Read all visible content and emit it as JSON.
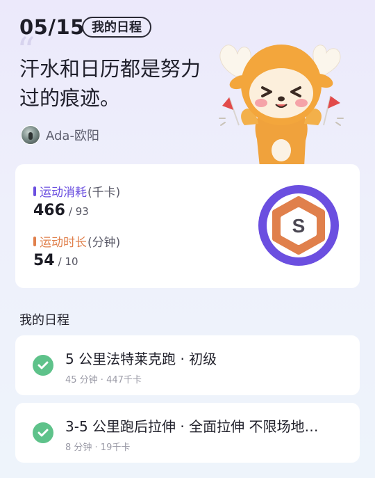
{
  "header": {
    "date": "05/15",
    "tag": "我的日程",
    "quote": "汗水和日历都是努力过的痕迹。",
    "user_name": "Ada-欧阳"
  },
  "stats": {
    "calories": {
      "label": "运动消耗",
      "unit": "(千卡)",
      "value": "466",
      "target": "/ 93",
      "color": "#6b4fe0"
    },
    "duration": {
      "label": "运动时长",
      "unit": "(分钟)",
      "value": "54",
      "target": "/ 10",
      "color": "#e0804c"
    },
    "badge_letter": "S",
    "badge_colors": {
      "outer": "#6b4fe0",
      "inner": "#e0804c"
    }
  },
  "schedule": {
    "title": "我的日程",
    "items": [
      {
        "title": "5 公里法特莱克跑 · 初级",
        "meta": "45 分钟 · 447千卡",
        "done": true
      },
      {
        "title": "3-5 公里跑后拉伸 · 全面拉伸 不限场地…",
        "meta": "8 分钟 · 19千卡",
        "done": true
      }
    ],
    "check_color": "#5ec28a"
  }
}
